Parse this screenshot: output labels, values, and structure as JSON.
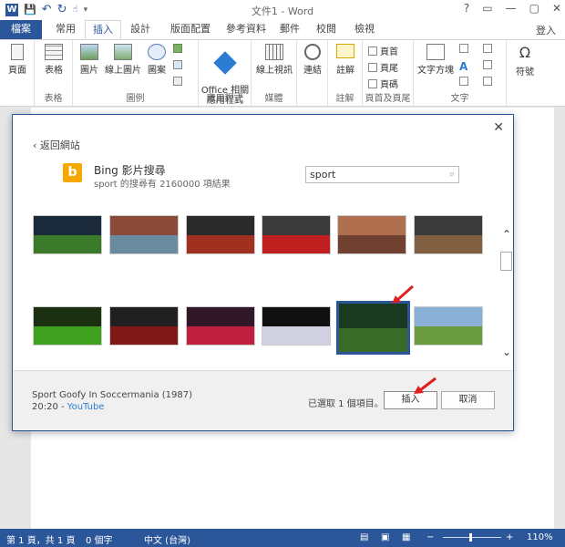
{
  "window": {
    "title": "文件1 - Word",
    "controls": [
      "?",
      "▭",
      "—",
      "▢",
      "✕"
    ]
  },
  "qat": {
    "save": "💾",
    "undo": "↶",
    "redo": "↻"
  },
  "tabs": [
    {
      "label": "檔案"
    },
    {
      "label": "常用"
    },
    {
      "label": "插入"
    },
    {
      "label": "設計"
    },
    {
      "label": "版面配置"
    },
    {
      "label": "參考資料"
    },
    {
      "label": "郵件"
    },
    {
      "label": "校閱"
    },
    {
      "label": "檢視"
    }
  ],
  "signin": "登入",
  "ribbon": {
    "groups": [
      {
        "label": ""
      },
      {
        "label": "表格"
      },
      {
        "label": "圖例"
      },
      {
        "label": "應用程式"
      },
      {
        "label": "媒體"
      },
      {
        "label": ""
      },
      {
        "label": "註解"
      },
      {
        "label": "頁首及頁尾"
      },
      {
        "label": "文字"
      },
      {
        "label": ""
      }
    ],
    "buttons": {
      "pages": "頁面",
      "table": "表格",
      "pictures": "圖片",
      "online_pictures": "線上圖片",
      "shapes": "圖案",
      "office_apps": "Office 相關\n應用程式",
      "online_video": "線上視訊",
      "links": "連結",
      "comment": "註解",
      "header": "頁首",
      "footer": "頁尾",
      "page_number": "頁碼",
      "textbox": "文字方塊",
      "symbol": "符號"
    }
  },
  "dialog": {
    "back": "返回網站",
    "search_title": "Bing 影片搜尋",
    "search_subtitle": "sport 的搜尋有 2160000 項結果",
    "search_value": "sport",
    "close": "✕",
    "video_title": "Sport Goofy In Soccermania (1987)",
    "video_duration": "20:20 -",
    "video_source": "YouTube",
    "selected_count": "已選取 1 個項目。",
    "insert_button": "插入",
    "cancel_button": "取消"
  },
  "statusbar": {
    "page": "第 1 頁，共 1 頁",
    "words": "0 個字",
    "language": "中文 (台灣)",
    "zoom": "110%"
  }
}
